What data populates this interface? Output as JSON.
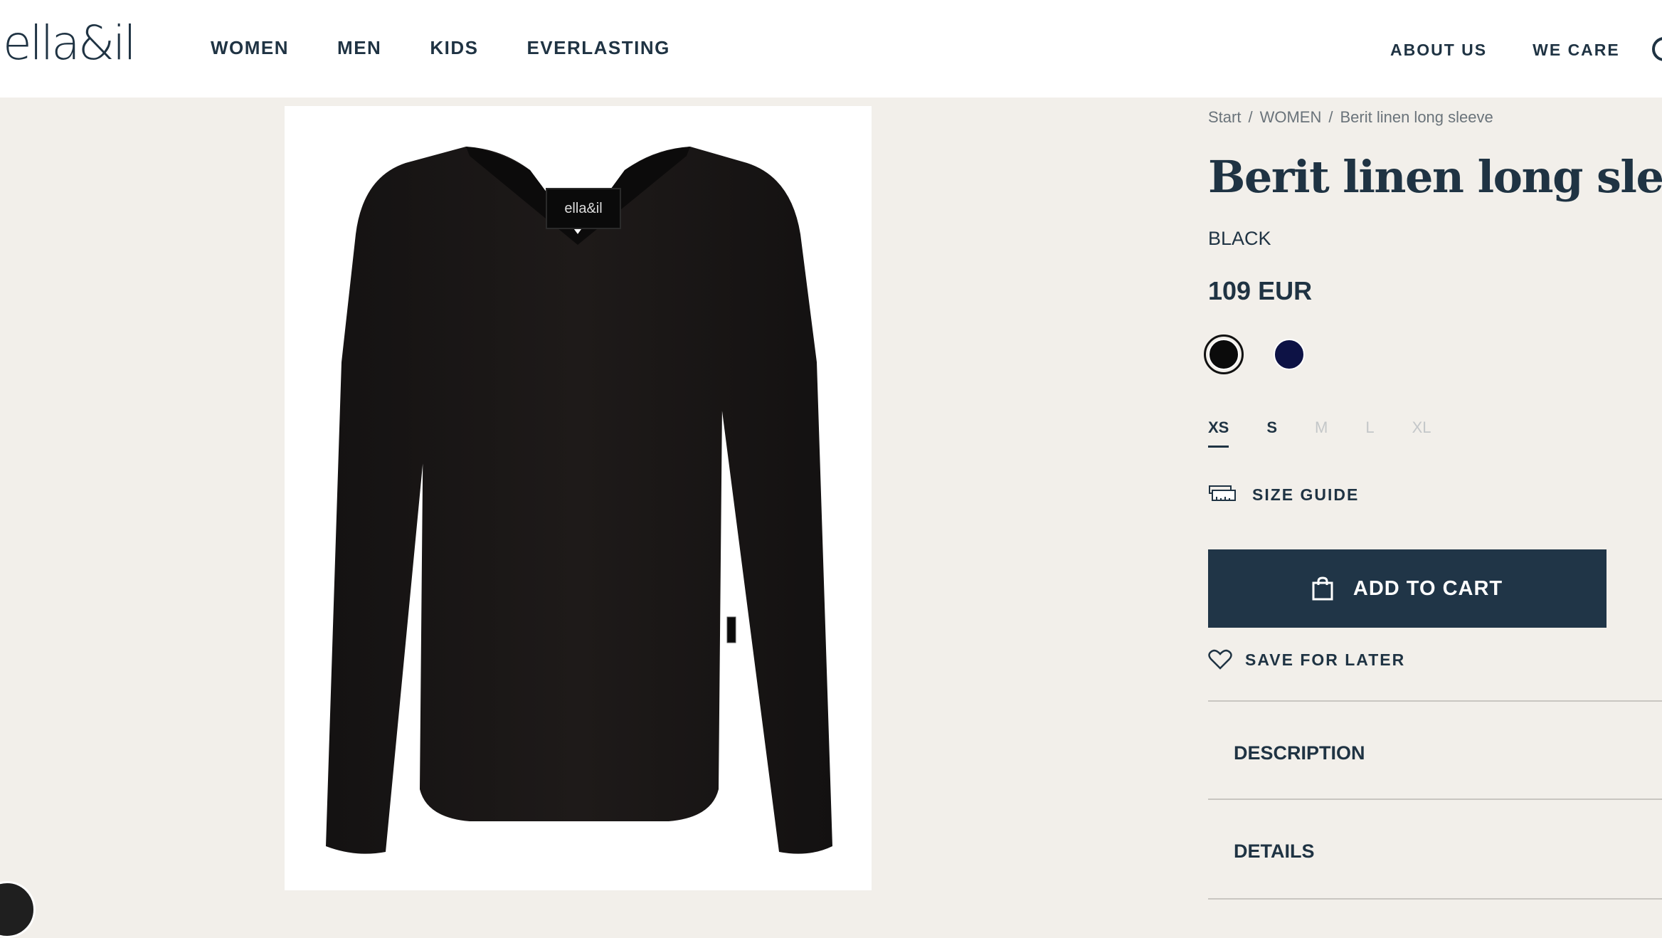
{
  "header": {
    "logo": "ella&il",
    "nav_main": [
      "WOMEN",
      "MEN",
      "KIDS",
      "EVERLASTING"
    ],
    "nav_right": [
      "ABOUT US",
      "WE CARE"
    ]
  },
  "breadcrumb": {
    "items": [
      "Start",
      "WOMEN",
      "Berit linen long sleeve"
    ],
    "separator": "/"
  },
  "product": {
    "title": "Berit linen long sleeve",
    "color_name": "BLACK",
    "price": "109 EUR",
    "image_label": "ella&il",
    "swatches": [
      {
        "color": "#0b0b0b",
        "selected": true
      },
      {
        "color": "#0d1245",
        "selected": false
      }
    ],
    "sizes": [
      {
        "label": "XS",
        "state": "active"
      },
      {
        "label": "S",
        "state": "available"
      },
      {
        "label": "M",
        "state": "disabled"
      },
      {
        "label": "L",
        "state": "disabled"
      },
      {
        "label": "XL",
        "state": "disabled"
      }
    ],
    "size_guide_label": "SIZE GUIDE",
    "add_to_cart_label": "ADD TO CART",
    "save_for_later_label": "SAVE FOR LATER",
    "accordions": [
      "DESCRIPTION",
      "DETAILS"
    ]
  },
  "colors": {
    "brand_dark": "#203547",
    "page_bg": "#f2efea"
  }
}
